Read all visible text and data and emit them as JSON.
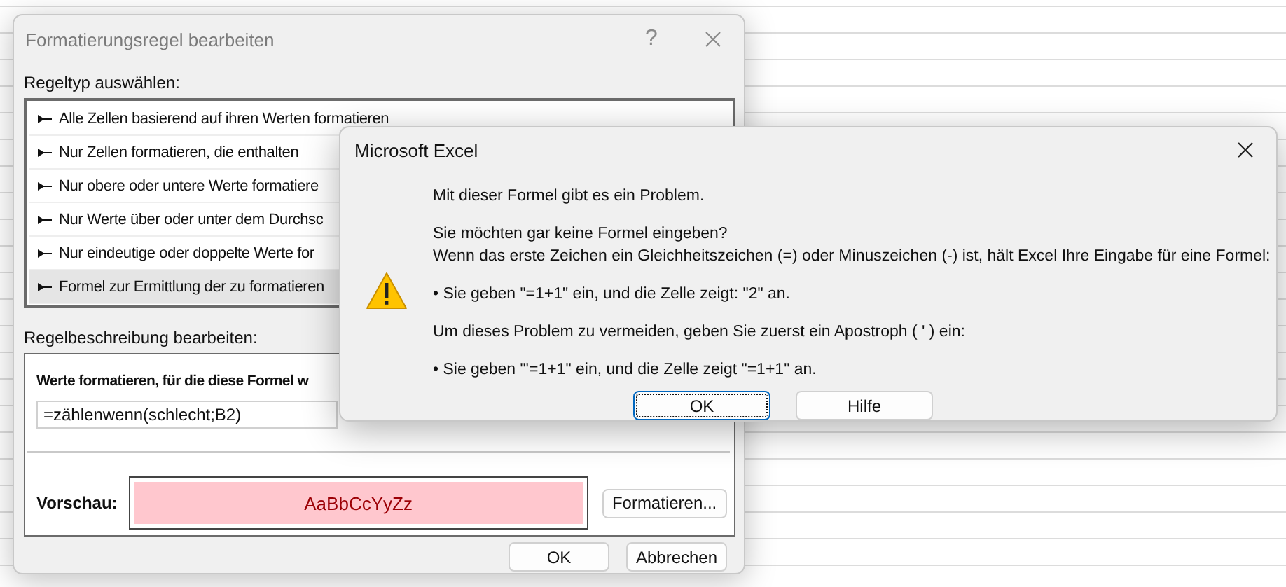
{
  "rule_dialog": {
    "title": "Formatierungsregel bearbeiten",
    "help_button": "?",
    "rule_type_label": "Regeltyp auswählen:",
    "rule_types": [
      {
        "label": "Alle Zellen basierend auf ihren Werten formatieren",
        "selected": false
      },
      {
        "label": "Nur Zellen formatieren, die enthalten",
        "selected": false
      },
      {
        "label": "Nur obere oder untere Werte formatiere",
        "selected": false
      },
      {
        "label": "Nur Werte über oder unter dem Durchsc",
        "selected": false
      },
      {
        "label": "Nur eindeutige oder doppelte Werte for",
        "selected": false
      },
      {
        "label": "Formel zur Ermittlung der zu formatieren",
        "selected": true
      }
    ],
    "description_label": "Regelbeschreibung bearbeiten:",
    "formula_label": "Werte formatieren, für die diese Formel w",
    "formula_value": "=zählenwenn(schlecht;B2)",
    "preview_label": "Vorschau:",
    "preview_sample": "AaBbCcYyZz",
    "format_button": "Formatieren...",
    "buttons": [
      "OK",
      "Abbrechen"
    ]
  },
  "message_box": {
    "title": "Microsoft Excel",
    "paragraphs": [
      [
        "Mit dieser Formel gibt es ein Problem."
      ],
      [
        "Sie möchten gar keine Formel eingeben?",
        "Wenn das erste Zeichen ein Gleichheitszeichen (=) oder Minuszeichen (-) ist, hält Excel Ihre Eingabe für eine Formel:"
      ],
      [
        "• Sie geben \"=1+1\" ein, und die Zelle zeigt: \"2\" an."
      ],
      [
        "Um dieses Problem zu vermeiden, geben Sie zuerst ein Apostroph ( ' ) ein:"
      ],
      [
        "• Sie geben \"'=1+1\" ein, und die Zelle zeigt \"=1+1\" an."
      ]
    ],
    "buttons": [
      {
        "label": "OK",
        "focused": true
      },
      {
        "label": "Hilfe",
        "focused": false
      }
    ]
  }
}
